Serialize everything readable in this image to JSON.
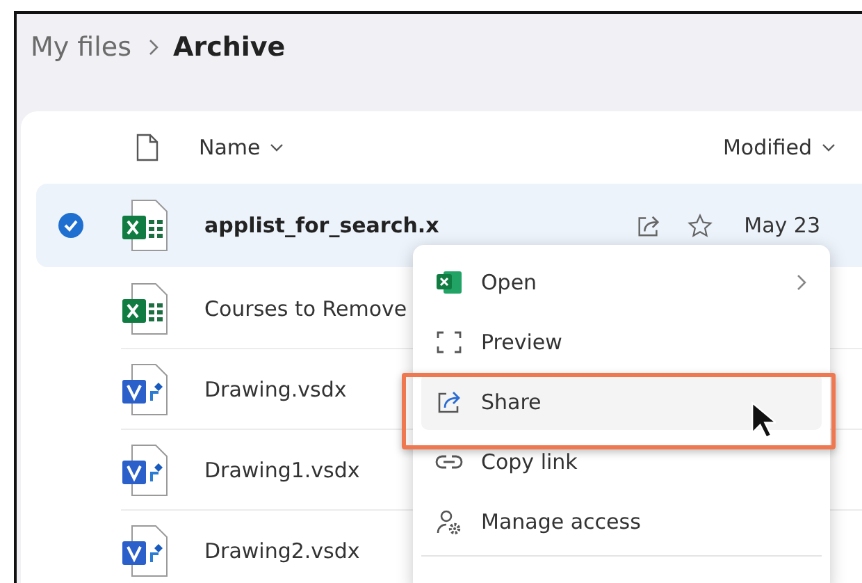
{
  "breadcrumb": [
    {
      "label": "My files",
      "current": false
    },
    {
      "label": "Archive",
      "current": true
    }
  ],
  "columns": [
    {
      "label": "Name"
    },
    {
      "label": "Modified"
    }
  ],
  "files": [
    {
      "name": "applist_for_search.x",
      "kind": "xlsx",
      "selected": true,
      "modified": "May 23",
      "actions": true
    },
    {
      "name": "Courses to Remove",
      "kind": "xlsx",
      "selected": false,
      "actions": false
    },
    {
      "name": "Drawing.vsdx",
      "kind": "vsdx",
      "selected": false,
      "actions": false
    },
    {
      "name": "Drawing1.vsdx",
      "kind": "vsdx",
      "selected": false,
      "actions": false
    },
    {
      "name": "Drawing2.vsdx",
      "kind": "vsdx",
      "selected": false,
      "actions": false
    }
  ],
  "context_menu": {
    "items": [
      {
        "label": "Open",
        "kind": "excel",
        "submenu": true,
        "highlighted": false
      },
      {
        "label": "Preview",
        "kind": "preview",
        "submenu": false,
        "highlighted": false
      },
      {
        "label": "Share",
        "kind": "share",
        "submenu": false,
        "highlighted": true
      },
      {
        "label": "Copy link",
        "kind": "link",
        "submenu": false,
        "highlighted": false
      },
      {
        "label": "Manage access",
        "kind": "access",
        "submenu": false,
        "highlighted": false
      }
    ]
  }
}
